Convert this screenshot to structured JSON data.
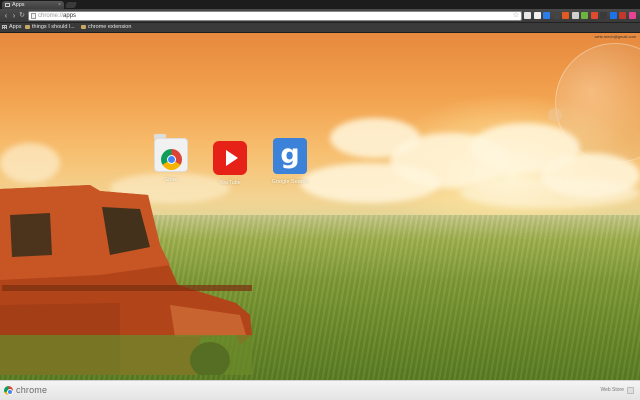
{
  "tab": {
    "title": "Apps",
    "close": "×"
  },
  "toolbar": {
    "back": "‹",
    "forward": "›",
    "reload": "↻",
    "url_scheme": "chrome://",
    "url_path": "apps",
    "star": "☆"
  },
  "bookmarks": [
    {
      "label": "Apps",
      "icon": "apps-grid-icon"
    },
    {
      "label": "things I should l...",
      "icon": "folder-icon"
    },
    {
      "label": "chrome extension",
      "icon": "folder-icon"
    }
  ],
  "user_email": "wetc.mech@gmail.com",
  "apps": [
    {
      "label": "Store",
      "icon": "chrome-web-store-icon"
    },
    {
      "label": "YouTube",
      "icon": "youtube-icon"
    },
    {
      "label": "Google Search",
      "icon": "google-search-icon"
    }
  ],
  "footer": {
    "brand": "chrome",
    "webstore": "Web Store"
  },
  "colors": {
    "youtube": "#e62117",
    "google_search": "#3b82d8",
    "omnibox_bg": "#ffffff",
    "toolbar": "#3f3f3f"
  },
  "extension_colors": [
    "#e8e8e8",
    "#f2f2f2",
    "#2b7de9",
    "#444444",
    "#e05a22",
    "#cfcfcf",
    "#6db33f",
    "#e44b2e",
    "#3a3a3a",
    "#1a73e8",
    "#c0392b",
    "#e84393"
  ]
}
